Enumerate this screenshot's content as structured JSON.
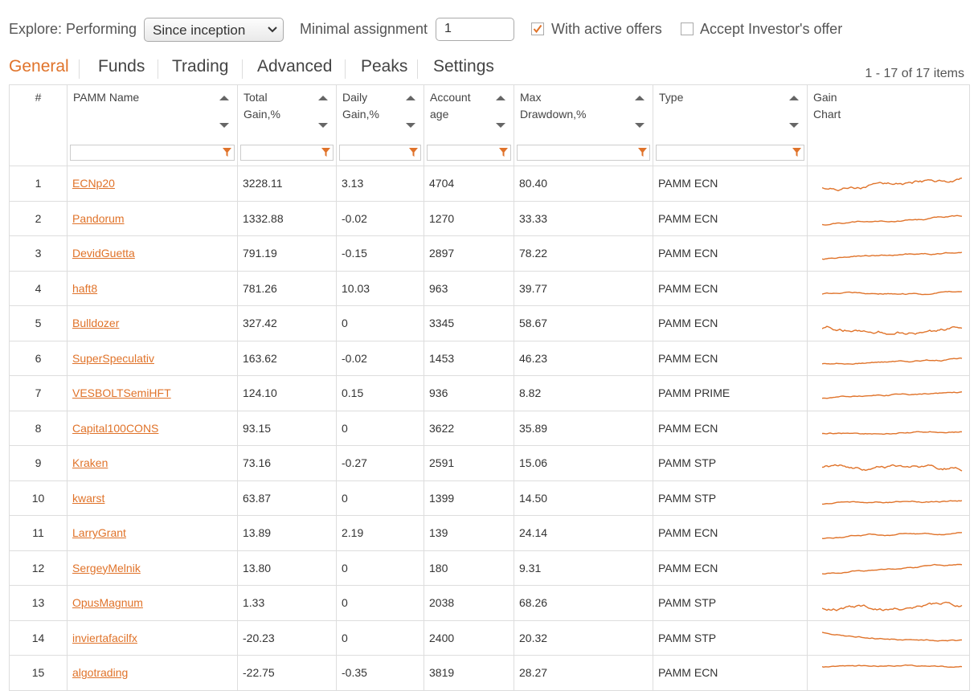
{
  "filters": {
    "explore_label": "Explore:",
    "performing_label": "Performing",
    "period_value": "Since inception",
    "min_assignment_label": "Minimal assignment",
    "min_assignment_value": "1",
    "active_offers_label": "With active offers",
    "active_offers_checked": true,
    "investor_offer_label": "Accept Investor's offer",
    "investor_offer_checked": false
  },
  "tabs": [
    {
      "label": "General",
      "active": true
    },
    {
      "label": "Funds",
      "active": false
    },
    {
      "label": "Trading",
      "active": false
    },
    {
      "label": "Advanced",
      "active": false
    },
    {
      "label": "Peaks",
      "active": false
    },
    {
      "label": "Settings",
      "active": false
    }
  ],
  "pager_text": "1 - 17 of 17 items",
  "columns": {
    "num": "#",
    "name": "PAMM Name",
    "total_gain": [
      "Total",
      "Gain,%"
    ],
    "daily_gain": [
      "Daily",
      "Gain,%"
    ],
    "account_age": [
      "Account",
      "age"
    ],
    "max_drawdown": [
      "Max",
      "Drawdown,%"
    ],
    "type": "Type",
    "gain_chart": [
      "Gain",
      "Chart"
    ]
  },
  "accent_color": "#e0732a",
  "rows": [
    {
      "num": "1",
      "name": "ECNp20",
      "total": "3228.11",
      "daily": "3.13",
      "age": "4704",
      "dd": "80.40",
      "type": "PAMM ECN"
    },
    {
      "num": "2",
      "name": "Pandorum",
      "total": "1332.88",
      "daily": "-0.02",
      "age": "1270",
      "dd": "33.33",
      "type": "PAMM ECN"
    },
    {
      "num": "3",
      "name": "DevidGuetta",
      "total": "791.19",
      "daily": "-0.15",
      "age": "2897",
      "dd": "78.22",
      "type": "PAMM ECN"
    },
    {
      "num": "4",
      "name": "haft8",
      "total": "781.26",
      "daily": "10.03",
      "age": "963",
      "dd": "39.77",
      "type": "PAMM ECN"
    },
    {
      "num": "5",
      "name": "Bulldozer",
      "total": "327.42",
      "daily": "0",
      "age": "3345",
      "dd": "58.67",
      "type": "PAMM ECN"
    },
    {
      "num": "6",
      "name": "SuperSpeculativ",
      "total": "163.62",
      "daily": "-0.02",
      "age": "1453",
      "dd": "46.23",
      "type": "PAMM ECN"
    },
    {
      "num": "7",
      "name": "VESBOLTSemiHFT",
      "total": "124.10",
      "daily": "0.15",
      "age": "936",
      "dd": "8.82",
      "type": "PAMM PRIME"
    },
    {
      "num": "8",
      "name": "Capital100CONS",
      "total": "93.15",
      "daily": "0",
      "age": "3622",
      "dd": "35.89",
      "type": "PAMM ECN"
    },
    {
      "num": "9",
      "name": "Kraken",
      "total": "73.16",
      "daily": "-0.27",
      "age": "2591",
      "dd": "15.06",
      "type": "PAMM STP"
    },
    {
      "num": "10",
      "name": "kwarst",
      "total": "63.87",
      "daily": "0",
      "age": "1399",
      "dd": "14.50",
      "type": "PAMM STP"
    },
    {
      "num": "11",
      "name": "LarryGrant",
      "total": "13.89",
      "daily": "2.19",
      "age": "139",
      "dd": "24.14",
      "type": "PAMM ECN"
    },
    {
      "num": "12",
      "name": "SergeyMelnik",
      "total": "13.80",
      "daily": "0",
      "age": "180",
      "dd": "9.31",
      "type": "PAMM ECN"
    },
    {
      "num": "13",
      "name": "OpusMagnum",
      "total": "1.33",
      "daily": "0",
      "age": "2038",
      "dd": "68.26",
      "type": "PAMM STP"
    },
    {
      "num": "14",
      "name": "inviertafacilfx",
      "total": "-20.23",
      "daily": "0",
      "age": "2400",
      "dd": "20.32",
      "type": "PAMM STP"
    },
    {
      "num": "15",
      "name": "algotrading",
      "total": "-22.75",
      "daily": "-0.35",
      "age": "3819",
      "dd": "28.27",
      "type": "PAMM ECN"
    }
  ]
}
